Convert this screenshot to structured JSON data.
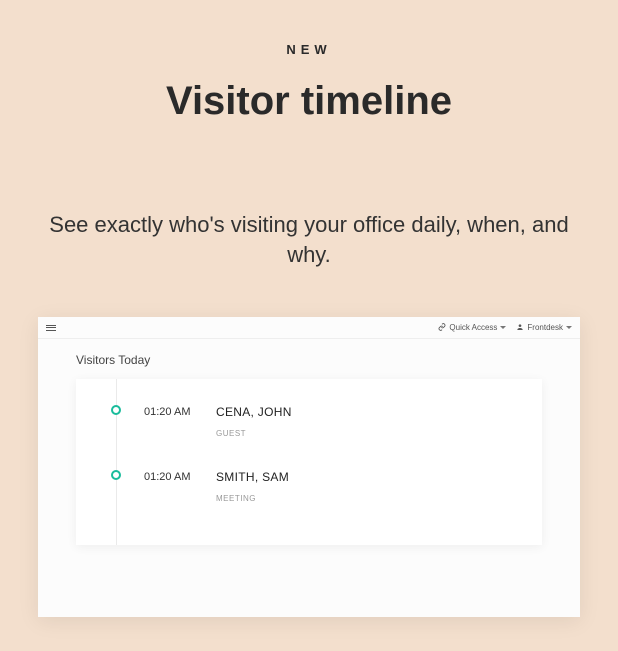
{
  "hero": {
    "eyebrow": "NEW",
    "title": "Visitor timeline",
    "subtitle": "See exactly who's visiting your office daily, when, and why."
  },
  "topbar": {
    "quick_access": "Quick Access",
    "user": "Frontdesk"
  },
  "section": {
    "title": "Visitors Today"
  },
  "entries": [
    {
      "time": "01:20 AM",
      "name": "CENA, JOHN",
      "type": "GUEST"
    },
    {
      "time": "01:20 AM",
      "name": "SMITH, SAM",
      "type": "MEETING"
    }
  ]
}
